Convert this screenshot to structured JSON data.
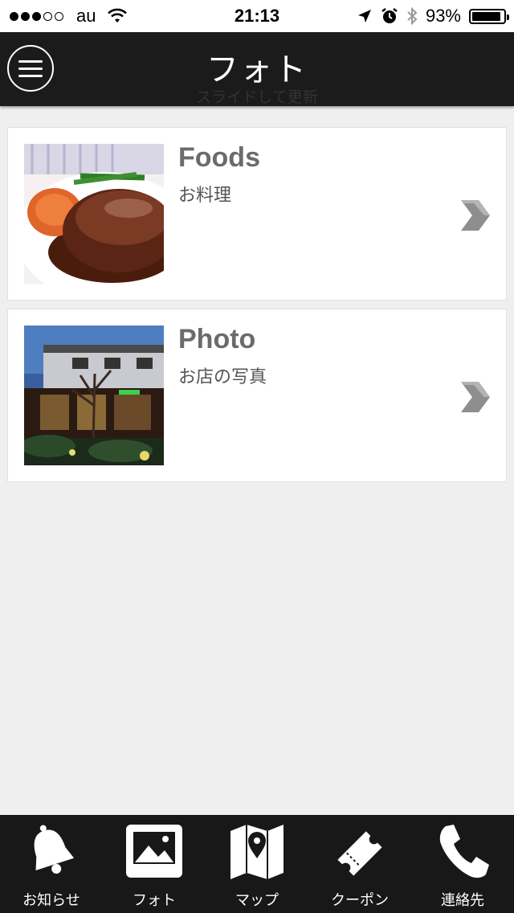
{
  "status_bar": {
    "carrier": "au",
    "time": "21:13",
    "battery": "93%",
    "battery_level": 0.93,
    "signal_bars_filled": 3,
    "signal_bars_total": 5
  },
  "nav": {
    "title": "フォト",
    "pull_hint": "スライドして更新"
  },
  "items": [
    {
      "title": "Foods",
      "subtitle": "お料理",
      "thumbnail": "hamburg-steak-photo"
    },
    {
      "title": "Photo",
      "subtitle": "お店の写真",
      "thumbnail": "restaurant-exterior-photo"
    }
  ],
  "tabs": [
    {
      "label": "お知らせ",
      "icon": "bell-icon"
    },
    {
      "label": "フォト",
      "icon": "photo-icon"
    },
    {
      "label": "マップ",
      "icon": "map-icon"
    },
    {
      "label": "クーポン",
      "icon": "ticket-icon"
    },
    {
      "label": "連絡先",
      "icon": "phone-icon"
    }
  ],
  "colors": {
    "nav_background": "#1b1b1b",
    "tab_background": "#181818",
    "page_background": "#efefef",
    "title_text": "#6b6b6b"
  }
}
